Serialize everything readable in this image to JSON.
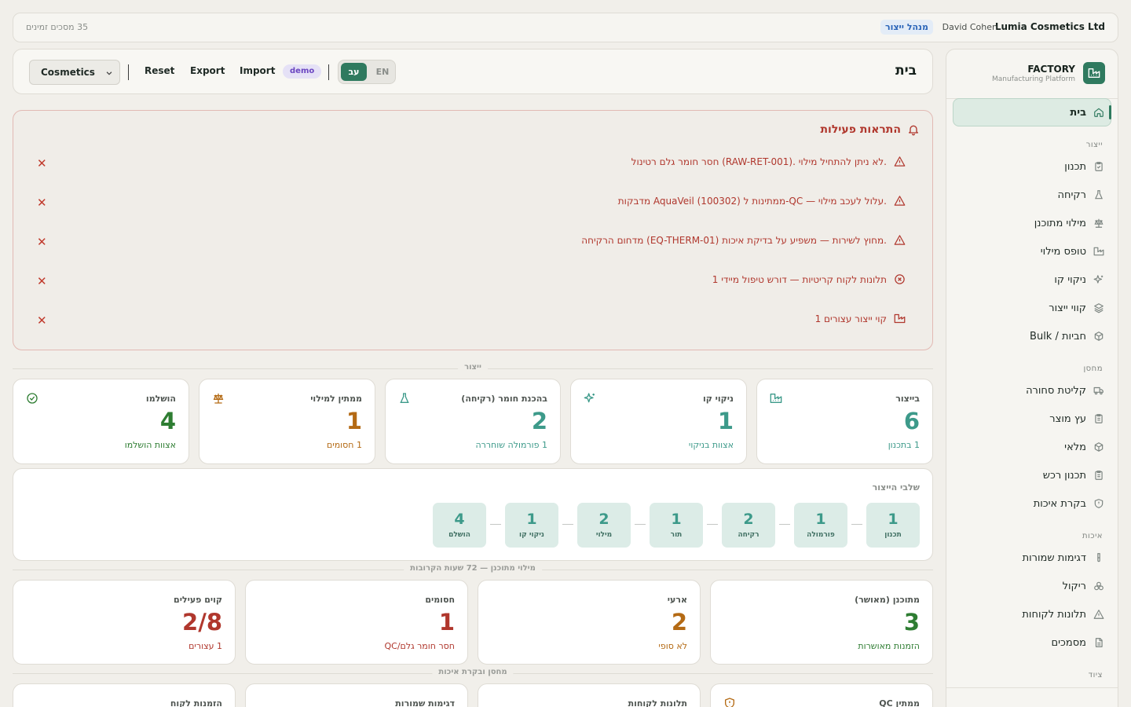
{
  "topbar": {
    "company": "Lumia Cosmetics Ltd",
    "user": "David Cohen",
    "role": "מנהל ייצור",
    "sessions": "35 מסכים זמינים"
  },
  "sidebar": {
    "brand_name": "FACTORY",
    "brand_sub": "Manufacturing Platform",
    "home": "בית",
    "sections": {
      "production": "ייצור",
      "warehouse": "מחסן",
      "quality": "איכות",
      "equipment": "ציוד"
    },
    "production_items": [
      {
        "label": "תכנון",
        "icon": "clipboard-icon"
      },
      {
        "label": "רקיחה",
        "icon": "flask-icon"
      },
      {
        "label": "מילוי מתוכנן",
        "icon": "scale-icon"
      },
      {
        "label": "טופס מילוי",
        "icon": "factory-icon"
      },
      {
        "label": "ניקוי קו",
        "icon": "sparkles-icon"
      },
      {
        "label": "קווי ייצור",
        "icon": "layers-icon"
      },
      {
        "label": "Bulk / חביות",
        "icon": "package-icon"
      }
    ],
    "warehouse_items": [
      {
        "label": "קליטת סחורה",
        "icon": "truck-icon"
      },
      {
        "label": "עץ מוצר",
        "icon": "clipboard-icon"
      },
      {
        "label": "מלאי",
        "icon": "package-icon"
      },
      {
        "label": "תכנון רכש",
        "icon": "clipboard-icon"
      },
      {
        "label": "בקרת איכות",
        "icon": "shield-icon"
      }
    ],
    "quality_items": [
      {
        "label": "דגימות שמורות",
        "icon": "test-tube-icon"
      },
      {
        "label": "ריקול",
        "icon": "biohazard-icon"
      },
      {
        "label": "תלונות לקוחות",
        "icon": "warning-icon"
      },
      {
        "label": "מסמכים",
        "icon": "document-icon"
      }
    ]
  },
  "header": {
    "title": "בית",
    "category_select": "Cosmetics",
    "reset": "Reset",
    "export": "Export",
    "import": "Import",
    "demo_badge": "demo",
    "lang_he": "עב",
    "lang_en": "EN"
  },
  "alerts": {
    "title": "התראות פעילות",
    "items": [
      {
        "text": "חסר חומר גלם רטינול (RAW-RET-001). לא ניתן להתחיל מילוי.",
        "icon": "warning-icon"
      },
      {
        "text": "מדבקות AquaVeil (100302) ממתינות ל-QC — עלול לעכב מילוי.",
        "icon": "warning-icon"
      },
      {
        "text": "מדחום הרקיחה (EQ-THERM-01) מחוץ לשירות — משפיע על בדיקת איכות.",
        "icon": "warning-icon"
      },
      {
        "text": "1 תלונות לקוח קריטיות — דורש טיפול מיידי",
        "icon": "x-circle-icon"
      },
      {
        "text": "1 קוי ייצור עצורים",
        "icon": "factory-icon"
      }
    ]
  },
  "dividers": {
    "production": "ייצור",
    "planned_filling": "מילוי מתוכנן — 72 שעות הקרובות",
    "warehouse_qc": "מחסן ובקרת איכות"
  },
  "production_cards": [
    {
      "label": "בייצור",
      "value": "6",
      "sub": "1 בתכנון",
      "icon": "factory-icon"
    },
    {
      "label": "ניקוי קו",
      "value": "1",
      "sub": "אצוות בניקוי",
      "icon": "sparkles-icon"
    },
    {
      "label": "בהכנת חומר (רקיחה)",
      "value": "2",
      "sub": "1 פורמולה שוחררה",
      "icon": "flask-icon"
    },
    {
      "label": "ממתין למילוי",
      "value": "1",
      "sub": "1 חסומים",
      "icon": "scale-icon"
    },
    {
      "label": "הושלמו",
      "value": "4",
      "sub": "אצוות הושלמו",
      "icon": "check-circle-icon"
    }
  ],
  "stages": {
    "title": "שלבי הייצור",
    "items": [
      {
        "value": "1",
        "label": "תכנון"
      },
      {
        "value": "1",
        "label": "פורמולה"
      },
      {
        "value": "2",
        "label": "רקיחה"
      },
      {
        "value": "1",
        "label": "תור"
      },
      {
        "value": "2",
        "label": "מילוי"
      },
      {
        "value": "1",
        "label": "ניקוי קו"
      },
      {
        "value": "4",
        "label": "הושלם"
      }
    ]
  },
  "filling_cards": [
    {
      "label": "מתוכנן (מאושר)",
      "value": "3",
      "sub": "הזמנות מאושרות"
    },
    {
      "label": "ארעי",
      "value": "2",
      "sub": "לא סופי"
    },
    {
      "label": "חסומים",
      "value": "1",
      "sub": "חסר חומר גלם/QC"
    },
    {
      "label": "קוים פעילים",
      "value": "2/8",
      "sub": "1 עצורים"
    }
  ],
  "warehouse_cards": [
    {
      "label": "ממתין QC",
      "icon": "shield-icon"
    },
    {
      "label": "תלונות לקוחות"
    },
    {
      "label": "דגימות שמורות"
    },
    {
      "label": "הזמנות לקוח"
    }
  ],
  "colors": {
    "primary": "#2f7a5f",
    "danger": "#b0372d",
    "amber": "#b46a14",
    "teal": "#3d9a8a",
    "green": "#2e7d32"
  }
}
